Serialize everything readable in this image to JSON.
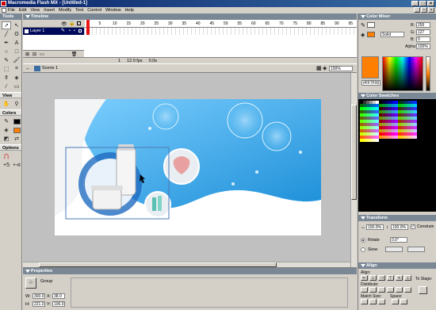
{
  "window": {
    "title": "Macromedia Flash MX - [Untitled-1]",
    "min": "_",
    "max": "□",
    "close": "×"
  },
  "menu": [
    "File",
    "Edit",
    "View",
    "Insert",
    "Modify",
    "Text",
    "Control",
    "Window",
    "Help"
  ],
  "tools": {
    "title": "Tools",
    "view_label": "View",
    "colors_label": "Colors",
    "options_label": "Options"
  },
  "timeline": {
    "title": "Timeline",
    "layer_name": "Layer 1",
    "frame_numbers": [
      "1",
      "5",
      "10",
      "15",
      "20",
      "25",
      "30",
      "35",
      "40",
      "45",
      "50",
      "55",
      "60",
      "65",
      "70",
      "75",
      "80",
      "85",
      "90",
      "95"
    ],
    "current_frame": "1",
    "fps": "12.0 fps",
    "time": "0.0s"
  },
  "scene": {
    "name": "Scene 1",
    "zoom": "100%"
  },
  "properties": {
    "title": "Properties",
    "type": "Group",
    "w_label": "W:",
    "w_value": "300.0",
    "h_label": "H:",
    "h_value": "221.0",
    "x_label": "X:",
    "x_value": "38.0",
    "y_label": "Y:",
    "y_value": "106.0"
  },
  "color_mixer": {
    "title": "Color Mixer",
    "fill_style": "Solid",
    "r_label": "R:",
    "r_value": "255",
    "g_label": "G:",
    "g_value": "127",
    "b_label": "B:",
    "b_value": "0",
    "alpha_label": "Alpha:",
    "alpha_value": "100%",
    "hex": "#FF7F00"
  },
  "color_swatches": {
    "title": "Color Swatches"
  },
  "transform": {
    "title": "Transform",
    "w_pct": "100.0%",
    "h_pct": "100.0%",
    "constrain": "Constrain",
    "rotate_label": "Rotate",
    "rotate_value": "0.0°",
    "skew_label": "Skew"
  },
  "align": {
    "title": "Align",
    "align_label": "Align:",
    "distribute_label": "Distribute:",
    "match_size_label": "Match Size:",
    "space_label": "Space:",
    "to_stage_label": "To Stage:"
  },
  "colors": {
    "title_bar": "#0a246a",
    "panel_header": "#7a8896",
    "stage_blue": "#3aa8e8",
    "accent_orange": "#ff7f00"
  }
}
